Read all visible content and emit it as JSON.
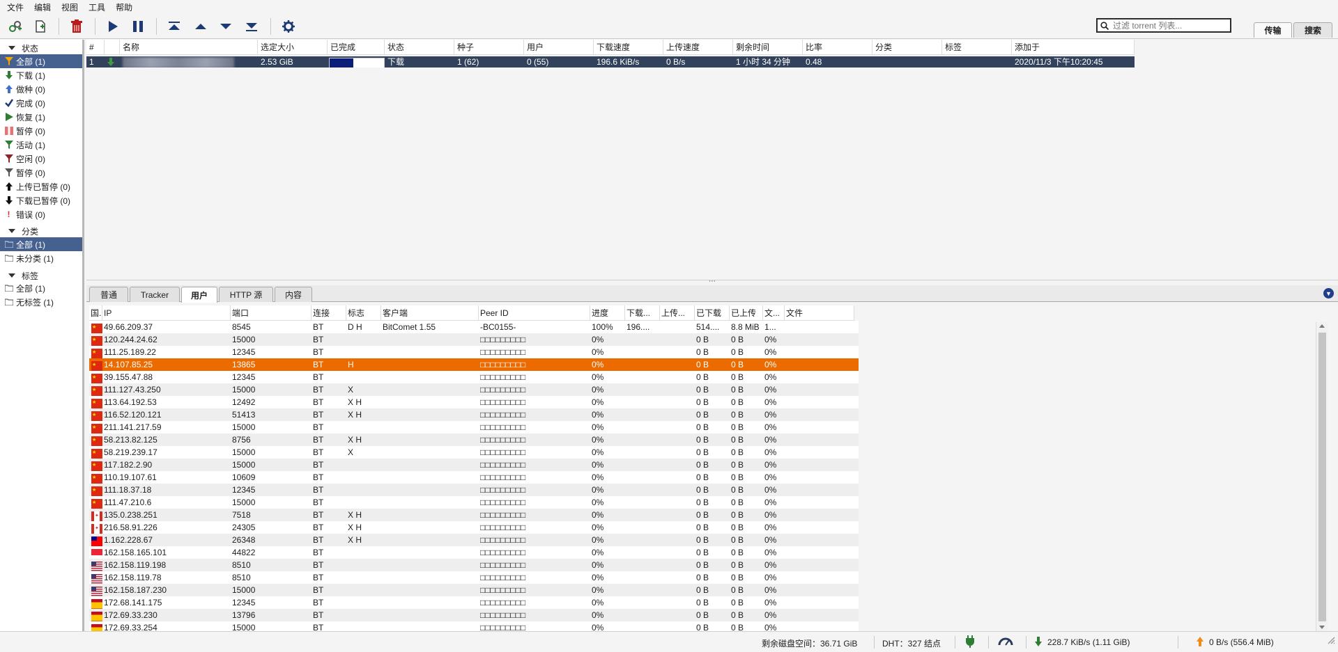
{
  "menu": [
    "文件",
    "编辑",
    "视图",
    "工具",
    "帮助"
  ],
  "search": {
    "placeholder": "过滤 torrent 列表..."
  },
  "top_tabs": {
    "transfers": "传输",
    "search": "搜索"
  },
  "sidebar": {
    "status_header": "状态",
    "status_items": [
      {
        "label": "全部 (1)",
        "icon": "filter-icon",
        "selected": true
      },
      {
        "label": "下载 (1)",
        "icon": "download-arrow-icon"
      },
      {
        "label": "做种 (0)",
        "icon": "upload-arrow-icon"
      },
      {
        "label": "完成 (0)",
        "icon": "checkmark-icon"
      },
      {
        "label": "恢复 (1)",
        "icon": "play-icon"
      },
      {
        "label": "暂停 (0)",
        "icon": "pause-icon"
      },
      {
        "label": "活动 (1)",
        "icon": "filter-green-icon"
      },
      {
        "label": "空闲 (0)",
        "icon": "filter-red-icon"
      },
      {
        "label": "暂停 (0)",
        "icon": "filter-gray-icon"
      },
      {
        "label": "上传已暂停 (0)",
        "icon": "upload-stalled-icon"
      },
      {
        "label": "下载已暂停 (0)",
        "icon": "download-stalled-icon"
      },
      {
        "label": "错误 (0)",
        "icon": "error-icon"
      }
    ],
    "category_header": "分类",
    "category_items": [
      {
        "label": "全部 (1)",
        "icon": "folder-icon",
        "selected": true
      },
      {
        "label": "未分类 (1)",
        "icon": "folder-icon"
      }
    ],
    "tag_header": "标签",
    "tag_items": [
      {
        "label": "全部 (1)",
        "icon": "folder-icon"
      },
      {
        "label": "无标签 (1)",
        "icon": "folder-icon"
      }
    ]
  },
  "torrent_table": {
    "columns": [
      "#",
      "",
      "名称",
      "选定大小",
      "已完成",
      "状态",
      "种子",
      "用户",
      "下载速度",
      "上传速度",
      "剩余时间",
      "比率",
      "分类",
      "标签",
      "添加于"
    ],
    "rows": [
      {
        "index": "1",
        "name": "",
        "size": "2.53 GiB",
        "progress_text": "44.2%",
        "progress": 0.442,
        "status": "下载",
        "seeds": "1 (62)",
        "peers": "0 (55)",
        "down_speed": "196.6 KiB/s",
        "up_speed": "0 B/s",
        "eta": "1 小时 34 分钟",
        "ratio": "0.48",
        "category": "",
        "tags": "",
        "added_on": "2020/11/3 下午10:20:45"
      }
    ]
  },
  "detail_tabs": [
    "普通",
    "Tracker",
    "用户",
    "HTTP 源",
    "内容"
  ],
  "detail_active_tab": 2,
  "peer_table": {
    "columns": [
      "国...",
      "IP",
      "端口",
      "连接",
      "标志",
      "客户端",
      "Peer ID",
      "进度",
      "下载...",
      "上传...",
      "已下载",
      "已上传",
      "文...",
      "文件"
    ],
    "rows": [
      {
        "flag": "cn",
        "ip": "49.66.209.37",
        "port": "8545",
        "conn": "BT",
        "flags": "D H",
        "client": "BitComet 1.55",
        "peer_id": "-BC0155-",
        "progress": "100%",
        "down": "196....",
        "up": "",
        "downloaded": "514....",
        "uploaded": "8.8 MiB",
        "relevance": "1...",
        "files": ""
      },
      {
        "flag": "cn",
        "ip": "120.244.24.62",
        "port": "15000",
        "conn": "BT",
        "flags": "",
        "client": "",
        "peer_id": "□□□□□□□□□",
        "progress": "0%",
        "down": "",
        "up": "",
        "downloaded": "0 B",
        "uploaded": "0 B",
        "relevance": "0%",
        "files": ""
      },
      {
        "flag": "cn",
        "ip": "111.25.189.22",
        "port": "12345",
        "conn": "BT",
        "flags": "",
        "client": "",
        "peer_id": "□□□□□□□□□",
        "progress": "0%",
        "down": "",
        "up": "",
        "downloaded": "0 B",
        "uploaded": "0 B",
        "relevance": "0%",
        "files": ""
      },
      {
        "flag": "cn",
        "ip": "14.107.85.25",
        "port": "13865",
        "conn": "BT",
        "flags": "H",
        "client": "",
        "peer_id": "□□□□□□□□□",
        "progress": "0%",
        "down": "",
        "up": "",
        "downloaded": "0 B",
        "uploaded": "0 B",
        "relevance": "0%",
        "files": "",
        "selected": true
      },
      {
        "flag": "cn",
        "ip": "39.155.47.88",
        "port": "12345",
        "conn": "BT",
        "flags": "",
        "client": "",
        "peer_id": "□□□□□□□□□",
        "progress": "0%",
        "down": "",
        "up": "",
        "downloaded": "0 B",
        "uploaded": "0 B",
        "relevance": "0%",
        "files": ""
      },
      {
        "flag": "cn",
        "ip": "111.127.43.250",
        "port": "15000",
        "conn": "BT",
        "flags": "X",
        "client": "",
        "peer_id": "□□□□□□□□□",
        "progress": "0%",
        "down": "",
        "up": "",
        "downloaded": "0 B",
        "uploaded": "0 B",
        "relevance": "0%",
        "files": ""
      },
      {
        "flag": "cn",
        "ip": "113.64.192.53",
        "port": "12492",
        "conn": "BT",
        "flags": "X H",
        "client": "",
        "peer_id": "□□□□□□□□□",
        "progress": "0%",
        "down": "",
        "up": "",
        "downloaded": "0 B",
        "uploaded": "0 B",
        "relevance": "0%",
        "files": ""
      },
      {
        "flag": "cn",
        "ip": "116.52.120.121",
        "port": "51413",
        "conn": "BT",
        "flags": "X H",
        "client": "",
        "peer_id": "□□□□□□□□□",
        "progress": "0%",
        "down": "",
        "up": "",
        "downloaded": "0 B",
        "uploaded": "0 B",
        "relevance": "0%",
        "files": ""
      },
      {
        "flag": "cn",
        "ip": "211.141.217.59",
        "port": "15000",
        "conn": "BT",
        "flags": "",
        "client": "",
        "peer_id": "□□□□□□□□□",
        "progress": "0%",
        "down": "",
        "up": "",
        "downloaded": "0 B",
        "uploaded": "0 B",
        "relevance": "0%",
        "files": ""
      },
      {
        "flag": "cn",
        "ip": "58.213.82.125",
        "port": "8756",
        "conn": "BT",
        "flags": "X H",
        "client": "",
        "peer_id": "□□□□□□□□□",
        "progress": "0%",
        "down": "",
        "up": "",
        "downloaded": "0 B",
        "uploaded": "0 B",
        "relevance": "0%",
        "files": ""
      },
      {
        "flag": "cn",
        "ip": "58.219.239.17",
        "port": "15000",
        "conn": "BT",
        "flags": "X",
        "client": "",
        "peer_id": "□□□□□□□□□",
        "progress": "0%",
        "down": "",
        "up": "",
        "downloaded": "0 B",
        "uploaded": "0 B",
        "relevance": "0%",
        "files": ""
      },
      {
        "flag": "cn",
        "ip": "117.182.2.90",
        "port": "15000",
        "conn": "BT",
        "flags": "",
        "client": "",
        "peer_id": "□□□□□□□□□",
        "progress": "0%",
        "down": "",
        "up": "",
        "downloaded": "0 B",
        "uploaded": "0 B",
        "relevance": "0%",
        "files": ""
      },
      {
        "flag": "cn",
        "ip": "110.19.107.61",
        "port": "10609",
        "conn": "BT",
        "flags": "",
        "client": "",
        "peer_id": "□□□□□□□□□",
        "progress": "0%",
        "down": "",
        "up": "",
        "downloaded": "0 B",
        "uploaded": "0 B",
        "relevance": "0%",
        "files": ""
      },
      {
        "flag": "cn",
        "ip": "111.18.37.18",
        "port": "12345",
        "conn": "BT",
        "flags": "",
        "client": "",
        "peer_id": "□□□□□□□□□",
        "progress": "0%",
        "down": "",
        "up": "",
        "downloaded": "0 B",
        "uploaded": "0 B",
        "relevance": "0%",
        "files": ""
      },
      {
        "flag": "cn",
        "ip": "111.47.210.6",
        "port": "15000",
        "conn": "BT",
        "flags": "",
        "client": "",
        "peer_id": "□□□□□□□□□",
        "progress": "0%",
        "down": "",
        "up": "",
        "downloaded": "0 B",
        "uploaded": "0 B",
        "relevance": "0%",
        "files": ""
      },
      {
        "flag": "ca",
        "ip": "135.0.238.251",
        "port": "7518",
        "conn": "BT",
        "flags": "X H",
        "client": "",
        "peer_id": "□□□□□□□□□",
        "progress": "0%",
        "down": "",
        "up": "",
        "downloaded": "0 B",
        "uploaded": "0 B",
        "relevance": "0%",
        "files": ""
      },
      {
        "flag": "ca",
        "ip": "216.58.91.226",
        "port": "24305",
        "conn": "BT",
        "flags": "X H",
        "client": "",
        "peer_id": "□□□□□□□□□",
        "progress": "0%",
        "down": "",
        "up": "",
        "downloaded": "0 B",
        "uploaded": "0 B",
        "relevance": "0%",
        "files": ""
      },
      {
        "flag": "tw",
        "ip": "1.162.228.67",
        "port": "26348",
        "conn": "BT",
        "flags": "X H",
        "client": "",
        "peer_id": "□□□□□□□□□",
        "progress": "0%",
        "down": "",
        "up": "",
        "downloaded": "0 B",
        "uploaded": "0 B",
        "relevance": "0%",
        "files": ""
      },
      {
        "flag": "sg",
        "ip": "162.158.165.101",
        "port": "44822",
        "conn": "BT",
        "flags": "",
        "client": "",
        "peer_id": "□□□□□□□□□",
        "progress": "0%",
        "down": "",
        "up": "",
        "downloaded": "0 B",
        "uploaded": "0 B",
        "relevance": "0%",
        "files": ""
      },
      {
        "flag": "us",
        "ip": "162.158.119.198",
        "port": "8510",
        "conn": "BT",
        "flags": "",
        "client": "",
        "peer_id": "□□□□□□□□□",
        "progress": "0%",
        "down": "",
        "up": "",
        "downloaded": "0 B",
        "uploaded": "0 B",
        "relevance": "0%",
        "files": ""
      },
      {
        "flag": "us",
        "ip": "162.158.119.78",
        "port": "8510",
        "conn": "BT",
        "flags": "",
        "client": "",
        "peer_id": "□□□□□□□□□",
        "progress": "0%",
        "down": "",
        "up": "",
        "downloaded": "0 B",
        "uploaded": "0 B",
        "relevance": "0%",
        "files": ""
      },
      {
        "flag": "us",
        "ip": "162.158.187.230",
        "port": "15000",
        "conn": "BT",
        "flags": "",
        "client": "",
        "peer_id": "□□□□□□□□□",
        "progress": "0%",
        "down": "",
        "up": "",
        "downloaded": "0 B",
        "uploaded": "0 B",
        "relevance": "0%",
        "files": ""
      },
      {
        "flag": "es",
        "ip": "172.68.141.175",
        "port": "12345",
        "conn": "BT",
        "flags": "",
        "client": "",
        "peer_id": "□□□□□□□□□",
        "progress": "0%",
        "down": "",
        "up": "",
        "downloaded": "0 B",
        "uploaded": "0 B",
        "relevance": "0%",
        "files": ""
      },
      {
        "flag": "es",
        "ip": "172.69.33.230",
        "port": "13796",
        "conn": "BT",
        "flags": "",
        "client": "",
        "peer_id": "□□□□□□□□□",
        "progress": "0%",
        "down": "",
        "up": "",
        "downloaded": "0 B",
        "uploaded": "0 B",
        "relevance": "0%",
        "files": ""
      },
      {
        "flag": "es",
        "ip": "172.69.33.254",
        "port": "15000",
        "conn": "BT",
        "flags": "",
        "client": "",
        "peer_id": "□□□□□□□□□",
        "progress": "0%",
        "down": "",
        "up": "",
        "downloaded": "0 B",
        "uploaded": "0 B",
        "relevance": "0%",
        "files": ""
      }
    ]
  },
  "statusbar": {
    "free_space": "剩余磁盘空间：36.71 GiB",
    "dht": "DHT：327 结点",
    "download": "228.7 KiB/s (1.11 GiB)",
    "upload": "0 B/s (556.4 MiB)"
  },
  "colors": {
    "selected_row": "#33425c",
    "selected_peer": "#ec6b00",
    "sidebar_selected": "#46608f",
    "accent": "#1f3f8a"
  }
}
